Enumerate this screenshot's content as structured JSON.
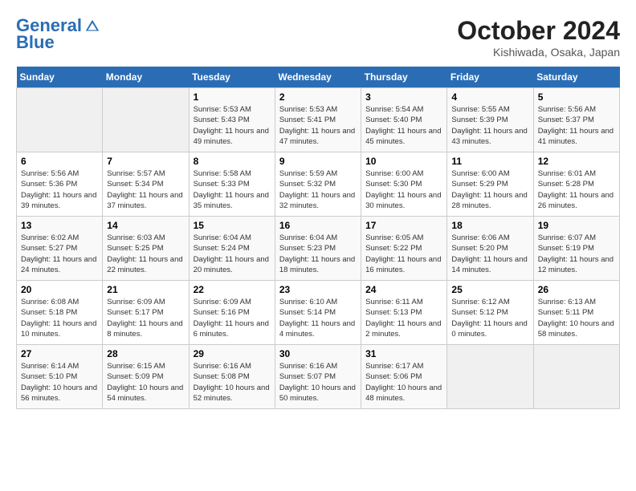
{
  "header": {
    "logo_line1": "General",
    "logo_line2": "Blue",
    "month": "October 2024",
    "location": "Kishiwada, Osaka, Japan"
  },
  "weekdays": [
    "Sunday",
    "Monday",
    "Tuesday",
    "Wednesday",
    "Thursday",
    "Friday",
    "Saturday"
  ],
  "weeks": [
    [
      {
        "day": "",
        "info": ""
      },
      {
        "day": "",
        "info": ""
      },
      {
        "day": "1",
        "info": "Sunrise: 5:53 AM\nSunset: 5:43 PM\nDaylight: 11 hours and 49 minutes."
      },
      {
        "day": "2",
        "info": "Sunrise: 5:53 AM\nSunset: 5:41 PM\nDaylight: 11 hours and 47 minutes."
      },
      {
        "day": "3",
        "info": "Sunrise: 5:54 AM\nSunset: 5:40 PM\nDaylight: 11 hours and 45 minutes."
      },
      {
        "day": "4",
        "info": "Sunrise: 5:55 AM\nSunset: 5:39 PM\nDaylight: 11 hours and 43 minutes."
      },
      {
        "day": "5",
        "info": "Sunrise: 5:56 AM\nSunset: 5:37 PM\nDaylight: 11 hours and 41 minutes."
      }
    ],
    [
      {
        "day": "6",
        "info": "Sunrise: 5:56 AM\nSunset: 5:36 PM\nDaylight: 11 hours and 39 minutes."
      },
      {
        "day": "7",
        "info": "Sunrise: 5:57 AM\nSunset: 5:34 PM\nDaylight: 11 hours and 37 minutes."
      },
      {
        "day": "8",
        "info": "Sunrise: 5:58 AM\nSunset: 5:33 PM\nDaylight: 11 hours and 35 minutes."
      },
      {
        "day": "9",
        "info": "Sunrise: 5:59 AM\nSunset: 5:32 PM\nDaylight: 11 hours and 32 minutes."
      },
      {
        "day": "10",
        "info": "Sunrise: 6:00 AM\nSunset: 5:30 PM\nDaylight: 11 hours and 30 minutes."
      },
      {
        "day": "11",
        "info": "Sunrise: 6:00 AM\nSunset: 5:29 PM\nDaylight: 11 hours and 28 minutes."
      },
      {
        "day": "12",
        "info": "Sunrise: 6:01 AM\nSunset: 5:28 PM\nDaylight: 11 hours and 26 minutes."
      }
    ],
    [
      {
        "day": "13",
        "info": "Sunrise: 6:02 AM\nSunset: 5:27 PM\nDaylight: 11 hours and 24 minutes."
      },
      {
        "day": "14",
        "info": "Sunrise: 6:03 AM\nSunset: 5:25 PM\nDaylight: 11 hours and 22 minutes."
      },
      {
        "day": "15",
        "info": "Sunrise: 6:04 AM\nSunset: 5:24 PM\nDaylight: 11 hours and 20 minutes."
      },
      {
        "day": "16",
        "info": "Sunrise: 6:04 AM\nSunset: 5:23 PM\nDaylight: 11 hours and 18 minutes."
      },
      {
        "day": "17",
        "info": "Sunrise: 6:05 AM\nSunset: 5:22 PM\nDaylight: 11 hours and 16 minutes."
      },
      {
        "day": "18",
        "info": "Sunrise: 6:06 AM\nSunset: 5:20 PM\nDaylight: 11 hours and 14 minutes."
      },
      {
        "day": "19",
        "info": "Sunrise: 6:07 AM\nSunset: 5:19 PM\nDaylight: 11 hours and 12 minutes."
      }
    ],
    [
      {
        "day": "20",
        "info": "Sunrise: 6:08 AM\nSunset: 5:18 PM\nDaylight: 11 hours and 10 minutes."
      },
      {
        "day": "21",
        "info": "Sunrise: 6:09 AM\nSunset: 5:17 PM\nDaylight: 11 hours and 8 minutes."
      },
      {
        "day": "22",
        "info": "Sunrise: 6:09 AM\nSunset: 5:16 PM\nDaylight: 11 hours and 6 minutes."
      },
      {
        "day": "23",
        "info": "Sunrise: 6:10 AM\nSunset: 5:14 PM\nDaylight: 11 hours and 4 minutes."
      },
      {
        "day": "24",
        "info": "Sunrise: 6:11 AM\nSunset: 5:13 PM\nDaylight: 11 hours and 2 minutes."
      },
      {
        "day": "25",
        "info": "Sunrise: 6:12 AM\nSunset: 5:12 PM\nDaylight: 11 hours and 0 minutes."
      },
      {
        "day": "26",
        "info": "Sunrise: 6:13 AM\nSunset: 5:11 PM\nDaylight: 10 hours and 58 minutes."
      }
    ],
    [
      {
        "day": "27",
        "info": "Sunrise: 6:14 AM\nSunset: 5:10 PM\nDaylight: 10 hours and 56 minutes."
      },
      {
        "day": "28",
        "info": "Sunrise: 6:15 AM\nSunset: 5:09 PM\nDaylight: 10 hours and 54 minutes."
      },
      {
        "day": "29",
        "info": "Sunrise: 6:16 AM\nSunset: 5:08 PM\nDaylight: 10 hours and 52 minutes."
      },
      {
        "day": "30",
        "info": "Sunrise: 6:16 AM\nSunset: 5:07 PM\nDaylight: 10 hours and 50 minutes."
      },
      {
        "day": "31",
        "info": "Sunrise: 6:17 AM\nSunset: 5:06 PM\nDaylight: 10 hours and 48 minutes."
      },
      {
        "day": "",
        "info": ""
      },
      {
        "day": "",
        "info": ""
      }
    ]
  ]
}
